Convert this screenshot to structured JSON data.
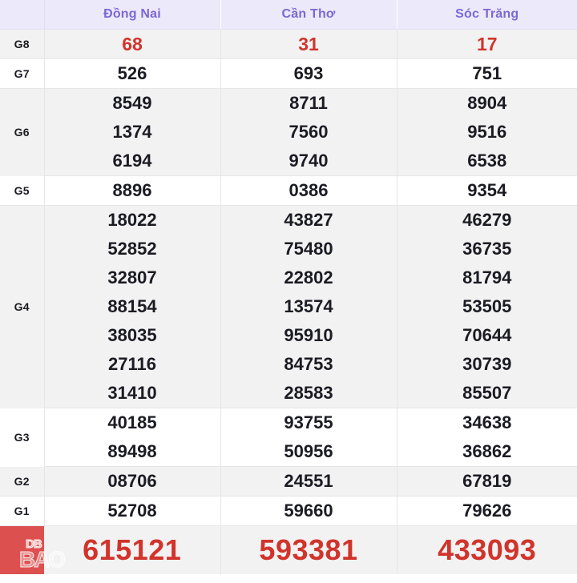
{
  "table": {
    "columns": [
      "",
      "Đồng Nai",
      "Cần Thơ",
      "Sóc Trăng"
    ],
    "blank_header": "",
    "rows": [
      {
        "label": "G8",
        "values": [
          [
            "68"
          ],
          [
            "31"
          ],
          [
            "17"
          ]
        ]
      },
      {
        "label": "G7",
        "values": [
          [
            "526"
          ],
          [
            "693"
          ],
          [
            "751"
          ]
        ]
      },
      {
        "label": "G6",
        "values": [
          [
            "8549",
            "1374",
            "6194"
          ],
          [
            "8711",
            "7560",
            "9740"
          ],
          [
            "8904",
            "9516",
            "6538"
          ]
        ]
      },
      {
        "label": "G5",
        "values": [
          [
            "8896"
          ],
          [
            "0386"
          ],
          [
            "9354"
          ]
        ]
      },
      {
        "label": "G4",
        "values": [
          [
            "18022",
            "52852",
            "32807",
            "88154",
            "38035",
            "27116",
            "31410"
          ],
          [
            "43827",
            "75480",
            "22802",
            "13574",
            "95910",
            "84753",
            "28583"
          ],
          [
            "46279",
            "36735",
            "81794",
            "53505",
            "70644",
            "30739",
            "85507"
          ]
        ]
      },
      {
        "label": "G3",
        "values": [
          [
            "40185",
            "89498"
          ],
          [
            "93755",
            "50956"
          ],
          [
            "34638",
            "36862"
          ]
        ]
      },
      {
        "label": "G2",
        "values": [
          [
            "08706"
          ],
          [
            "24551"
          ],
          [
            "67819"
          ]
        ]
      },
      {
        "label": "G1",
        "values": [
          [
            "52708"
          ],
          [
            "59660"
          ],
          [
            "79626"
          ]
        ]
      }
    ],
    "special": {
      "label": "",
      "values": [
        "615121",
        "593381",
        "433093"
      ]
    }
  },
  "watermark": {
    "line1": "DB",
    "line2": "BAO"
  },
  "colors": {
    "header_bg": "#ece9fb",
    "header_text": "#7b68d4",
    "stripe_bg": "#f2f2f2",
    "plain_bg": "#ffffff",
    "number_text": "#1b1b23",
    "highlight_red": "#d1342c",
    "special_label_bg": "#dd5050",
    "border": "#e6e6e6"
  },
  "cells": {
    "g8": {
      "dn": "68",
      "ct": "31",
      "st": "17"
    },
    "g7": {
      "dn": "526",
      "ct": "693",
      "st": "751"
    },
    "g6": {
      "dn1": "8549",
      "ct1": "8711",
      "st1": "8904",
      "dn2": "1374",
      "ct2": "7560",
      "st2": "9516",
      "dn3": "6194",
      "ct3": "9740",
      "st3": "6538"
    },
    "g5": {
      "dn": "8896",
      "ct": "0386",
      "st": "9354"
    },
    "g4": {
      "dn1": "18022",
      "ct1": "43827",
      "st1": "46279",
      "dn2": "52852",
      "ct2": "75480",
      "st2": "36735",
      "dn3": "32807",
      "ct3": "22802",
      "st3": "81794",
      "dn4": "88154",
      "ct4": "13574",
      "st4": "53505",
      "dn5": "38035",
      "ct5": "95910",
      "st5": "70644",
      "dn6": "27116",
      "ct6": "84753",
      "st6": "30739",
      "dn7": "31410",
      "ct7": "28583",
      "st7": "85507"
    },
    "g3": {
      "dn1": "40185",
      "ct1": "93755",
      "st1": "34638",
      "dn2": "89498",
      "ct2": "50956",
      "st2": "36862"
    },
    "g2": {
      "dn": "08706",
      "ct": "24551",
      "st": "67819"
    },
    "g1": {
      "dn": "52708",
      "ct": "59660",
      "st": "79626"
    },
    "db": {
      "dn": "615121",
      "ct": "593381",
      "st": "433093"
    }
  },
  "labels": {
    "g8": "G8",
    "g7": "G7",
    "g6": "G6",
    "g5": "G5",
    "g4": "G4",
    "g3": "G3",
    "g2": "G2",
    "g1": "G1",
    "db": ""
  }
}
